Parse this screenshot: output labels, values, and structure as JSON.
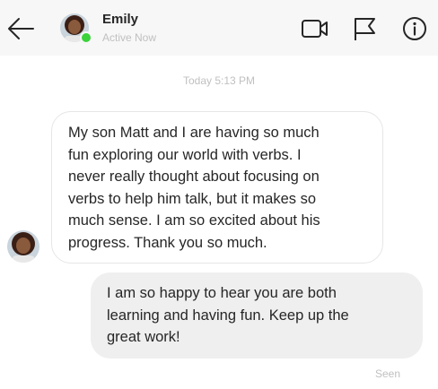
{
  "header": {
    "contact_name": "Emily",
    "contact_status": "Active Now",
    "back_icon": "arrow-left-icon",
    "actions": [
      "video-call-icon",
      "flag-icon",
      "info-icon"
    ],
    "online_color": "#3bd23b"
  },
  "thread": {
    "timestamp": "Today 5:13 PM",
    "messages": [
      {
        "direction": "incoming",
        "text": "My son Matt and I are having so much\nfun exploring our world with verbs. I\nnever really thought about focusing on\nverbs to help him talk, but it makes so\nmuch sense. I am so excited about his\nprogress. Thank you so much."
      },
      {
        "direction": "outgoing",
        "text": "I am so happy to hear you are both\nlearning and having fun. Keep up the\ngreat work!"
      }
    ],
    "read_receipt": "Seen"
  }
}
